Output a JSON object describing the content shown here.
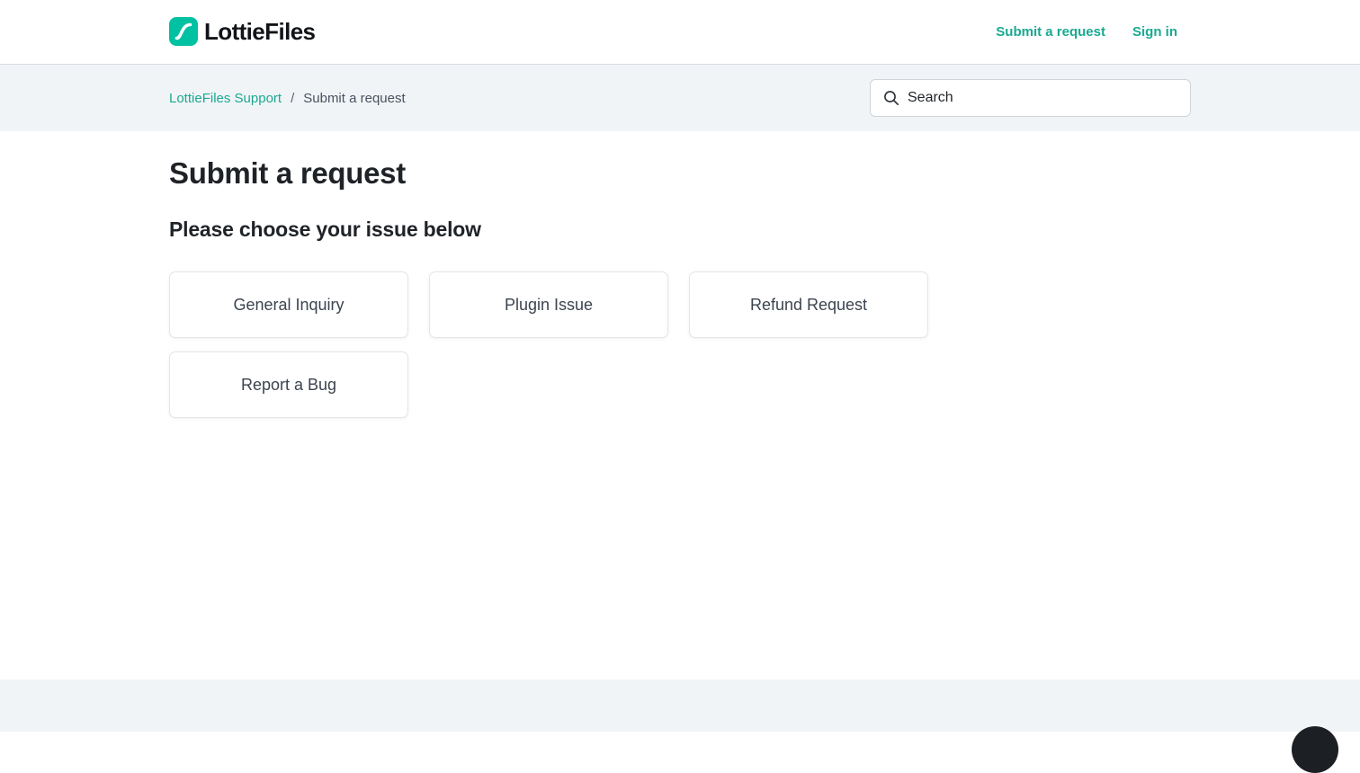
{
  "colors": {
    "brand": "#00c1a2",
    "link": "#1aa991",
    "text": "#1f2328",
    "muted_band": "#f1f4f7",
    "chat_bubble": "#1c1f24"
  },
  "header": {
    "logo_text": "LottieFiles",
    "logo_icon": "lottiefiles-logo-icon",
    "nav": {
      "submit_request": "Submit a request",
      "sign_in": "Sign in"
    }
  },
  "breadcrumb": {
    "home": "LottieFiles Support",
    "separator": "/",
    "current": "Submit a request"
  },
  "search": {
    "icon": "search-icon",
    "placeholder": "Search"
  },
  "main": {
    "title": "Submit a request",
    "subtitle": "Please choose your issue below",
    "issues": [
      {
        "label": "General Inquiry"
      },
      {
        "label": "Plugin Issue"
      },
      {
        "label": "Refund Request"
      },
      {
        "label": "Report a Bug"
      }
    ]
  },
  "chat": {
    "icon": "chat-launcher-icon"
  }
}
